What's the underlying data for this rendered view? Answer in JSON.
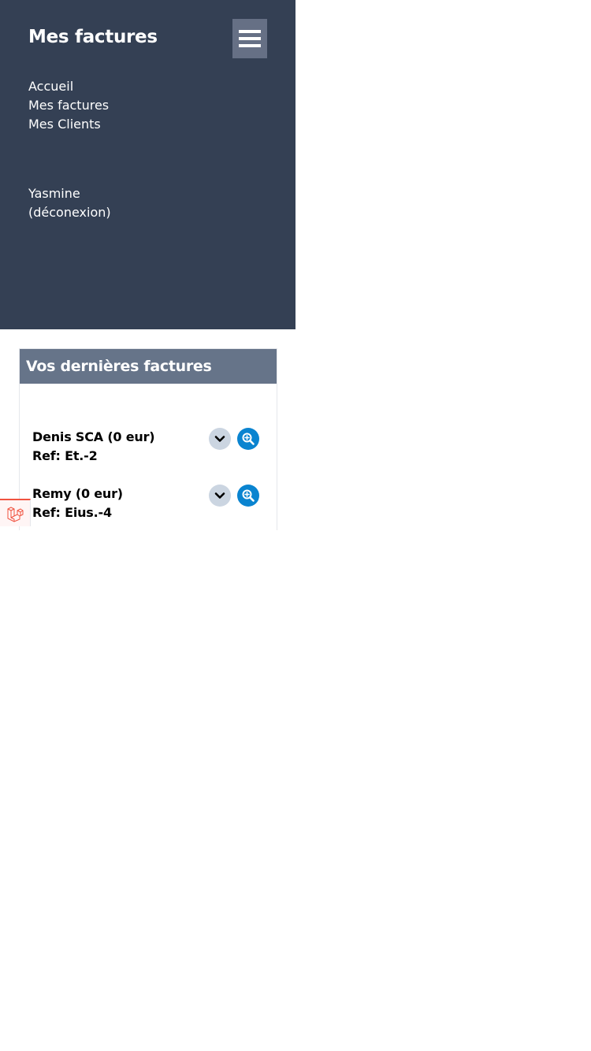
{
  "sidebar": {
    "brand": "Mes factures",
    "nav": [
      {
        "label": "Accueil"
      },
      {
        "label": "Mes factures"
      },
      {
        "label": "Mes Clients"
      }
    ],
    "user_name": "Yasmine",
    "logout_label": "(déconexion)",
    "menu_icon": "hamburger-icon"
  },
  "card": {
    "title": "Vos dernières factures",
    "invoices": [
      {
        "title": "Denis SCA (0 eur)",
        "ref": "Ref: Et.-2"
      },
      {
        "title": "Remy (0 eur)",
        "ref": "Ref: Eius.-4"
      }
    ],
    "expand_icon": "chevron-down-icon",
    "view_icon": "zoom-in-icon"
  },
  "colors": {
    "sidebar_bg": "#344054",
    "header_bg": "#667489",
    "view_button": "#0a84d0",
    "expand_button": "#cbd5e1",
    "laravel_red": "#f05340"
  }
}
